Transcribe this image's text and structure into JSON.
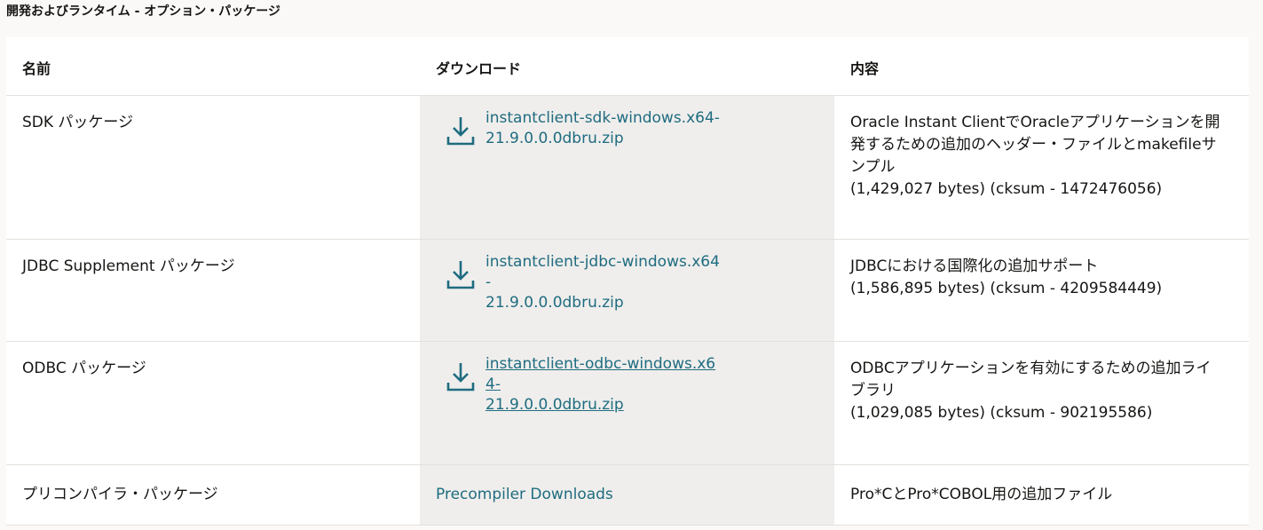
{
  "section_title": "開発およびランタイム - オプション・パッケージ",
  "table": {
    "headers": [
      "名前",
      "ダウンロード",
      "内容"
    ],
    "rows": [
      {
        "name": "SDK パッケージ",
        "download": {
          "line1": "instantclient-sdk-windows.x64-",
          "line2": "21.9.0.0.0dbru.zip",
          "icon": "download-icon"
        },
        "description": [
          "Oracle Instant ClientでOracleアプリケーションを開",
          "発するための追加のヘッダー・ファイルとmakefileサ",
          "ンプル",
          "(1,429,027 bytes) (cksum - 1472476056)"
        ]
      },
      {
        "name": "JDBC Supplement パッケージ",
        "download": {
          "line1": "instantclient-jdbc-windows.x64-",
          "line2": "21.9.0.0.0dbru.zip",
          "icon": "download-icon"
        },
        "description": [
          "JDBCにおける国際化の追加サポート",
          "(1,586,895 bytes) (cksum - 4209584449)"
        ]
      },
      {
        "name": "ODBC パッケージ",
        "download": {
          "line1": "instantclient-odbc-windows.x64-",
          "line2": "21.9.0.0.0dbru.zip",
          "icon": "download-icon"
        },
        "description": [
          "ODBCアプリケーションを有効にするための追加ライ",
          "ブラリ",
          "(1,029,085 bytes) (cksum - 902195586)"
        ]
      },
      {
        "name": "プリコンパイラ・パッケージ",
        "download": {
          "link": "Precompiler Downloads"
        },
        "description": [
          "Pro*CとPro*COBOL用の追加ファイル"
        ]
      }
    ]
  },
  "colors": {
    "link": "#1f6c80",
    "download_bg": "#efeeec",
    "background": "#fbf9f8"
  }
}
